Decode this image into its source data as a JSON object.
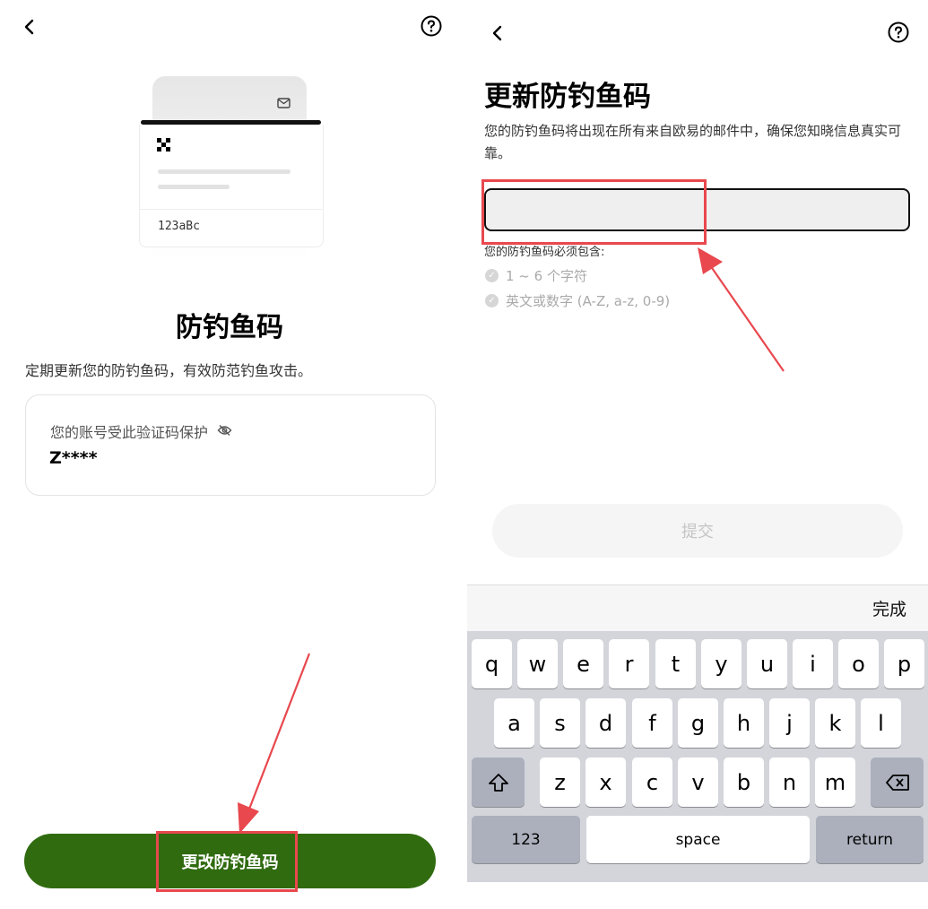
{
  "left": {
    "illustration": {
      "code": "123aBc"
    },
    "title": "防钓鱼码",
    "description": "定期更新您的防钓鱼码，有效防范钓鱼攻击。",
    "protect_card": {
      "label": "您的账号受此验证码保护",
      "value": "Z****"
    },
    "change_button": "更改防钓鱼码"
  },
  "right": {
    "title": "更新防钓鱼码",
    "description": "您的防钓鱼码将出现在所有来自欧易的邮件中，确保您知晓信息真实可靠。",
    "input": {
      "value": "",
      "placeholder": ""
    },
    "requirements_title": "您的防钓鱼码必须包含:",
    "requirements": [
      "1 ~ 6 个字符",
      "英文或数字 (A-Z,  a-z,  0-9)"
    ],
    "submit_button": "提交",
    "keyboard": {
      "done": "完成",
      "row1": [
        "q",
        "w",
        "e",
        "r",
        "t",
        "y",
        "u",
        "i",
        "o",
        "p"
      ],
      "row2": [
        "a",
        "s",
        "d",
        "f",
        "g",
        "h",
        "j",
        "k",
        "l"
      ],
      "row3": [
        "z",
        "x",
        "c",
        "v",
        "b",
        "n",
        "m"
      ],
      "numbers_key": "123",
      "space_key": "space",
      "return_key": "return"
    }
  },
  "annotation_color": "#e8484e",
  "accent_color": "#306b10"
}
